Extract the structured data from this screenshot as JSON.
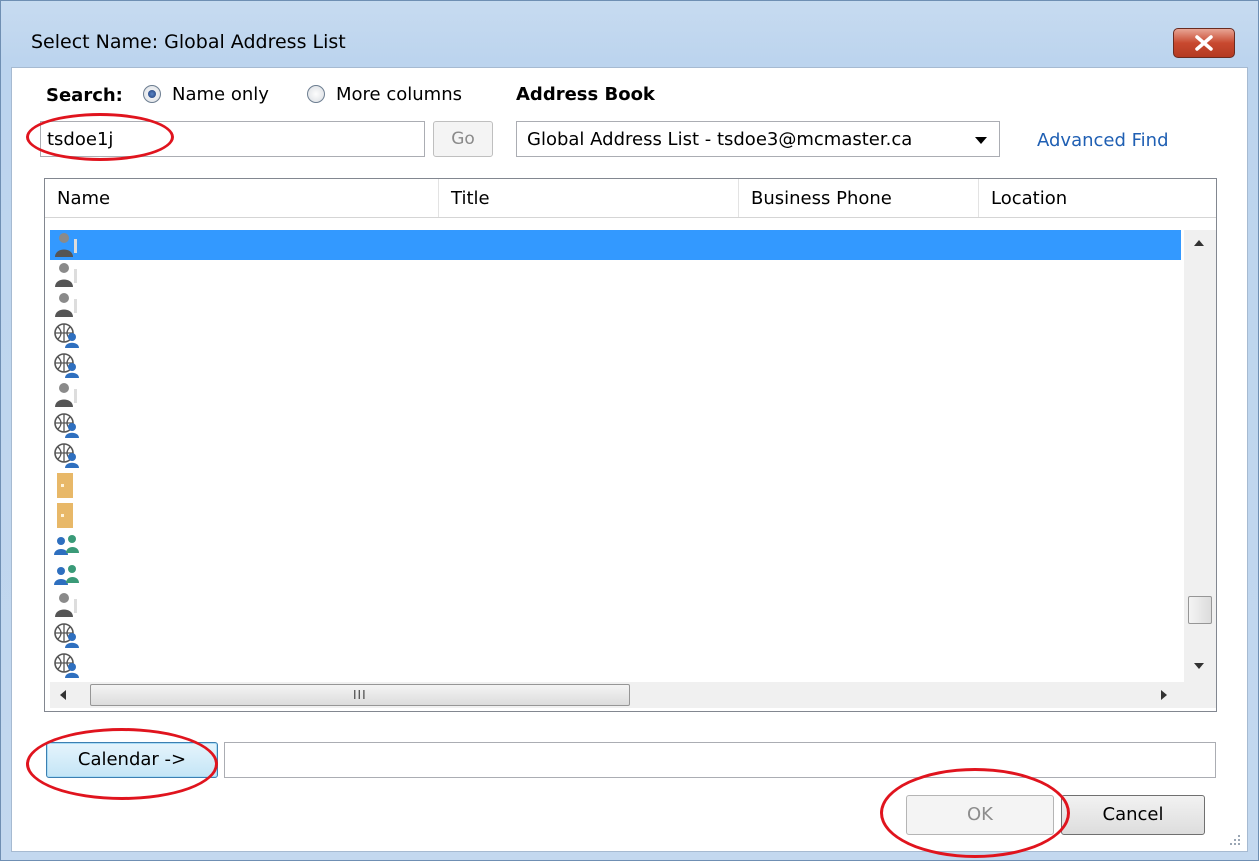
{
  "window": {
    "title": "Select Name: Global Address List"
  },
  "search": {
    "label": "Search:",
    "options": [
      "Name only",
      "More columns"
    ],
    "selected": "Name only",
    "value": "tsdoe1j",
    "go_label": "Go"
  },
  "address_book": {
    "label": "Address Book",
    "selected": "Global Address List - tsdoe3@mcmaster.ca",
    "advanced_find_label": "Advanced Find"
  },
  "list": {
    "columns": [
      "Name",
      "Title",
      "Business Phone",
      "Location"
    ],
    "rows": [
      {
        "icon": "person-icon",
        "selected": true
      },
      {
        "icon": "person-icon"
      },
      {
        "icon": "person-icon"
      },
      {
        "icon": "external-contact-icon"
      },
      {
        "icon": "external-contact-icon"
      },
      {
        "icon": "person-icon"
      },
      {
        "icon": "external-contact-icon"
      },
      {
        "icon": "external-contact-icon"
      },
      {
        "icon": "room-icon"
      },
      {
        "icon": "room-icon"
      },
      {
        "icon": "group-icon"
      },
      {
        "icon": "group-icon"
      },
      {
        "icon": "person-icon"
      },
      {
        "icon": "external-contact-icon"
      },
      {
        "icon": "external-contact-icon"
      }
    ],
    "horizontal_scroll_grip": "III"
  },
  "footer": {
    "calendar_label": "Calendar ->",
    "calendar_value": "",
    "ok_label": "OK",
    "cancel_label": "Cancel"
  },
  "colors": {
    "selection": "#3399ff",
    "link": "#1f5fb3",
    "annotation": "#e0141e"
  }
}
